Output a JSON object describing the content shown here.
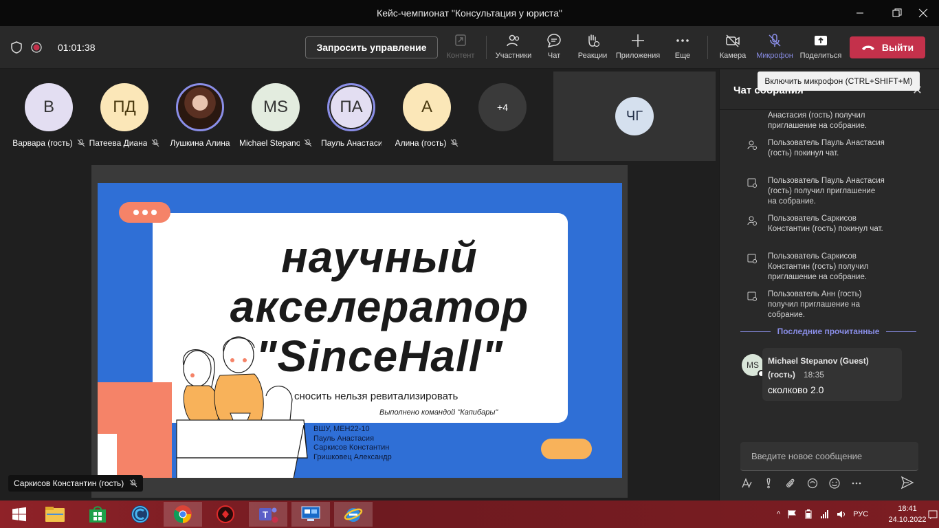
{
  "window": {
    "title": "Кейс-чемпионат \"Консультация у юриста\""
  },
  "toolbar": {
    "timer": "01:01:38",
    "request_control": "Запросить управление",
    "content": "Контент",
    "participants": "Участники",
    "chat": "Чат",
    "reactions": "Реакции",
    "apps": "Приложения",
    "more": "Еще",
    "camera": "Камера",
    "mic": "Микрофон",
    "share": "Поделиться",
    "leave": "Выйти"
  },
  "tooltip": "Включить микрофон (CTRL+SHIFT+M)",
  "participants": [
    {
      "initials": "В",
      "name": "Варвара (гость)",
      "color": "#e3def2"
    },
    {
      "initials": "ПД",
      "name": "Патеева Диана",
      "color": "#fbe7b8"
    },
    {
      "initials": "",
      "name": "Лушкина Алина",
      "color": "#8b5a4a"
    },
    {
      "initials": "MS",
      "name": "Michael Stepanov",
      "color": "#e3ecdf"
    },
    {
      "initials": "ПА",
      "name": "Пауль Анастасия",
      "color": "#e3def2"
    },
    {
      "initials": "А",
      "name": "Алина (гость)",
      "color": "#fbe7b8"
    }
  ],
  "overflow": "+4",
  "large_tile": {
    "initials": "ЧГ"
  },
  "slide": {
    "title_line1": "научный",
    "title_line2": "акселератор",
    "title_line3": "\"SinceHall\"",
    "subtitle": "сносить нельзя ревитализировать",
    "team": "Выполнено командой \"Капибары\"",
    "list": [
      "ВШУ, МЕН22-10",
      "Пауль Анастасия",
      "Саркисов Константин",
      "Гришковец Александр"
    ]
  },
  "presenter_label": "Саркисов Константин (гость)",
  "chat": {
    "header": "Чат собрания",
    "system_messages": [
      "Анастасия (гость) получил приглашение на собрание.",
      "Пользователь Пауль Анастасия (гость) покинул чат.",
      "Пользователь Пауль Анастасия (гость) получил приглашение на собрание.",
      "Пользователь Саркисов Константин (гость) покинул чат.",
      "Пользователь Саркисов Константин (гость) получил приглашение на собрание.",
      "Пользователь Анн (гость) получил приглашение на собрание."
    ],
    "last_read": "Последние прочитанные",
    "message": {
      "avatar": "MS",
      "author": "Michael Stepanov (Guest) (гость)",
      "time": "18:35",
      "text": "сколково 2.0"
    },
    "input_placeholder": "Введите новое сообщение"
  },
  "taskbar": {
    "lang": "РУС",
    "time": "18:41",
    "date": "24.10.2022"
  },
  "colors": {
    "accent": "#8a8ee8",
    "leave": "#c4314b",
    "slide_blue": "#2f6fd6",
    "taskbar": "#7c1d22"
  }
}
